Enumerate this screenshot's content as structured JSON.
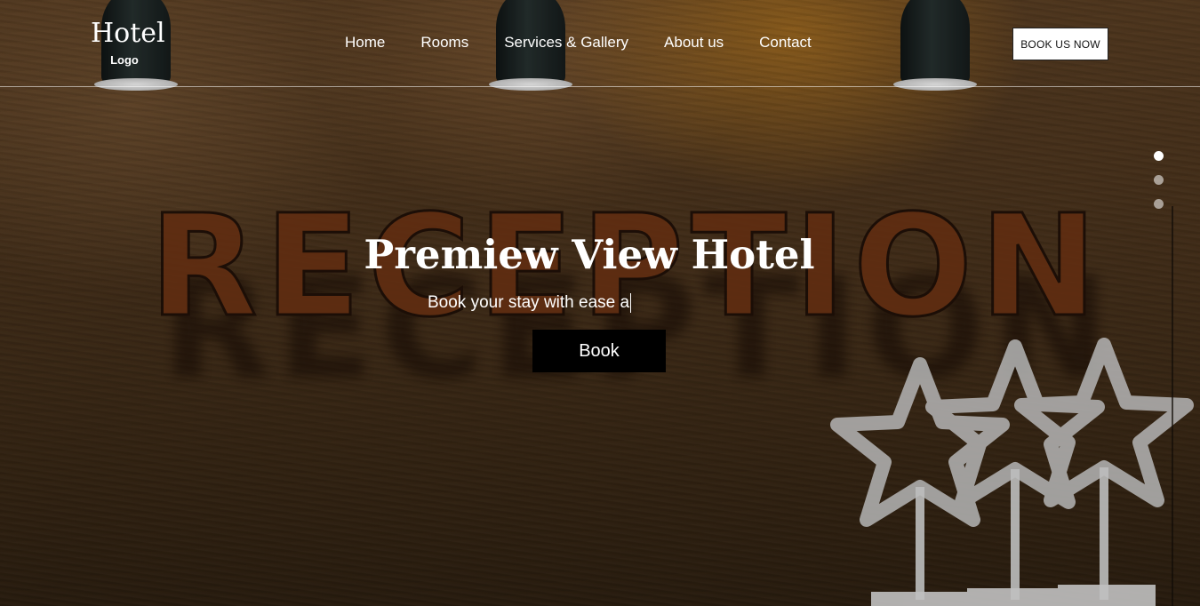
{
  "header": {
    "logo_title": "Hotel",
    "logo_sub": "Logo",
    "nav": [
      {
        "label": "Home"
      },
      {
        "label": "Rooms"
      },
      {
        "label": "Services & Gallery"
      },
      {
        "label": "About us"
      },
      {
        "label": "Contact"
      }
    ],
    "cta_label": "BOOK US NOW"
  },
  "hero": {
    "background_text": "RECEPTION",
    "title": "Premiew View Hotel",
    "subtitle": "Book your stay with ease a",
    "button_label": "Book"
  },
  "slider": {
    "dots": 3,
    "active_index": 0
  },
  "colors": {
    "accent": "#000000",
    "text": "#ffffff",
    "background_tone": "#4a331c",
    "lamp_glow": "#d68c1e"
  }
}
